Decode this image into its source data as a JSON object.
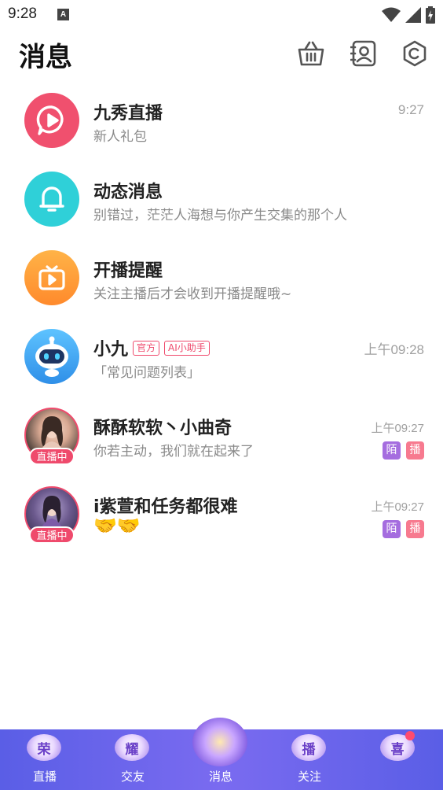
{
  "status_bar": {
    "time": "9:28",
    "a_badge": "A"
  },
  "header": {
    "title": "消息",
    "icons": [
      "basket-icon",
      "contacts-icon",
      "settings-hexagon-icon"
    ]
  },
  "messages": [
    {
      "title": "九秀直播",
      "subtitle": "新人礼包",
      "time": "9:27",
      "icon": "play-bubble-icon",
      "color": "#f0506e"
    },
    {
      "title": "动态消息",
      "subtitle": "别错过，茫茫人海想与你产生交集的那个人",
      "time": "",
      "icon": "bell-icon",
      "color": "#2fd0d8"
    },
    {
      "title": "开播提醒",
      "subtitle": "关注主播后才会收到开播提醒哦~",
      "time": "",
      "icon": "tv-icon",
      "color": "#ff9a3c"
    },
    {
      "title": "小九",
      "tags": [
        "官方",
        "AI小助手"
      ],
      "subtitle": "「常见问题列表」",
      "time": "上午09:28",
      "icon": "robot-icon"
    },
    {
      "title": "酥酥软软丶小曲奇",
      "subtitle": "你若主动，我们就在起来了",
      "time": "上午09:27",
      "live": "直播中",
      "badges": [
        "陌",
        "播"
      ]
    },
    {
      "title": "i紫萱和任务都很难",
      "subtitle": "🤝🤝",
      "time": "上午09:27",
      "live": "直播中",
      "badges": [
        "陌",
        "播"
      ]
    }
  ],
  "bottom_nav": {
    "items": [
      {
        "label": "直播",
        "badge_char": "荣"
      },
      {
        "label": "交友",
        "badge_char": "耀"
      },
      {
        "label": "消息",
        "badge_char": ""
      },
      {
        "label": "关注",
        "badge_char": "播"
      },
      {
        "label": "",
        "badge_char": "喜"
      }
    ]
  },
  "colors": {
    "accent": "#ef4a6c",
    "nav_bg": "#6a63ec",
    "tag_purple": "#a56ddf",
    "tag_pink": "#f77a8f"
  }
}
